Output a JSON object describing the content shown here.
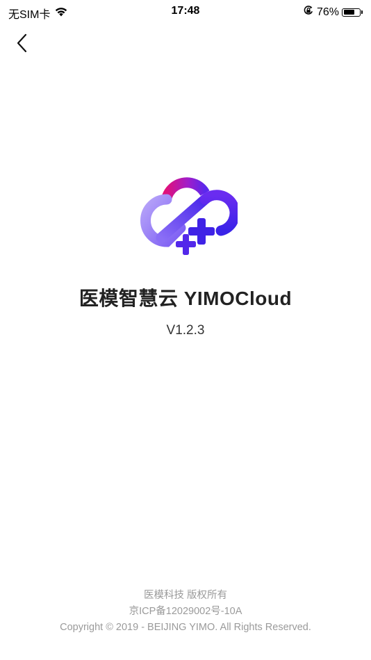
{
  "status_bar": {
    "carrier": "无SIM卡",
    "time": "17:48",
    "battery_percent": "76%",
    "battery_level": 0.76
  },
  "nav": {
    "back_icon": "chevron-left-icon"
  },
  "about": {
    "logo_icon": "yimo-cloud-logo-icon",
    "title": "医模智慧云 YIMOCloud",
    "version": "V1.2.3"
  },
  "footer": {
    "company_rights": "医模科技 版权所有",
    "icp": "京ICP备12029002号-10A",
    "copyright": "Copyright © 2019 - BEIJING YIMO. All Rights Reserved."
  },
  "colors": {
    "logo_gradient_start": "#e0117a",
    "logo_gradient_mid": "#7a2cf0",
    "logo_gradient_end": "#3a23e8",
    "logo_light": "#a996f7"
  }
}
